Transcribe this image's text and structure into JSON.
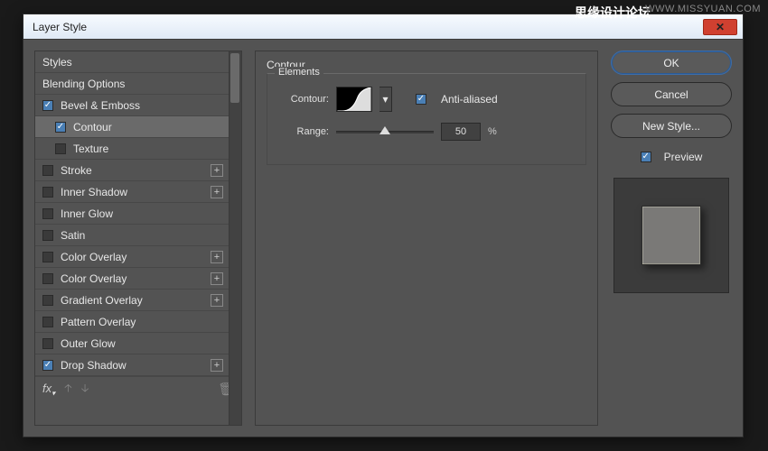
{
  "watermark": {
    "cn": "思缘设计论坛",
    "en": "WWW.MISSYUAN.COM"
  },
  "dialog": {
    "title": "Layer Style"
  },
  "styles": {
    "header": "Styles",
    "blending": "Blending Options",
    "items": [
      {
        "label": "Bevel & Emboss",
        "checked": true,
        "add": false,
        "sub": false
      },
      {
        "label": "Contour",
        "checked": true,
        "add": false,
        "sub": true,
        "selected": true
      },
      {
        "label": "Texture",
        "checked": false,
        "add": false,
        "sub": true
      },
      {
        "label": "Stroke",
        "checked": false,
        "add": true
      },
      {
        "label": "Inner Shadow",
        "checked": false,
        "add": true
      },
      {
        "label": "Inner Glow",
        "checked": false,
        "add": false
      },
      {
        "label": "Satin",
        "checked": false,
        "add": false
      },
      {
        "label": "Color Overlay",
        "checked": false,
        "add": true
      },
      {
        "label": "Color Overlay",
        "checked": false,
        "add": true
      },
      {
        "label": "Gradient Overlay",
        "checked": false,
        "add": true
      },
      {
        "label": "Pattern Overlay",
        "checked": false,
        "add": false
      },
      {
        "label": "Outer Glow",
        "checked": false,
        "add": false
      },
      {
        "label": "Drop Shadow",
        "checked": true,
        "add": true
      }
    ]
  },
  "contour": {
    "section": "Contour",
    "group": "Elements",
    "contour_label": "Contour:",
    "antialias_label": "Anti-aliased",
    "antialias": true,
    "range_label": "Range:",
    "range_value": "50",
    "range_unit": "%"
  },
  "buttons": {
    "ok": "OK",
    "cancel": "Cancel",
    "new_style": "New Style...",
    "preview": "Preview",
    "preview_on": true
  }
}
